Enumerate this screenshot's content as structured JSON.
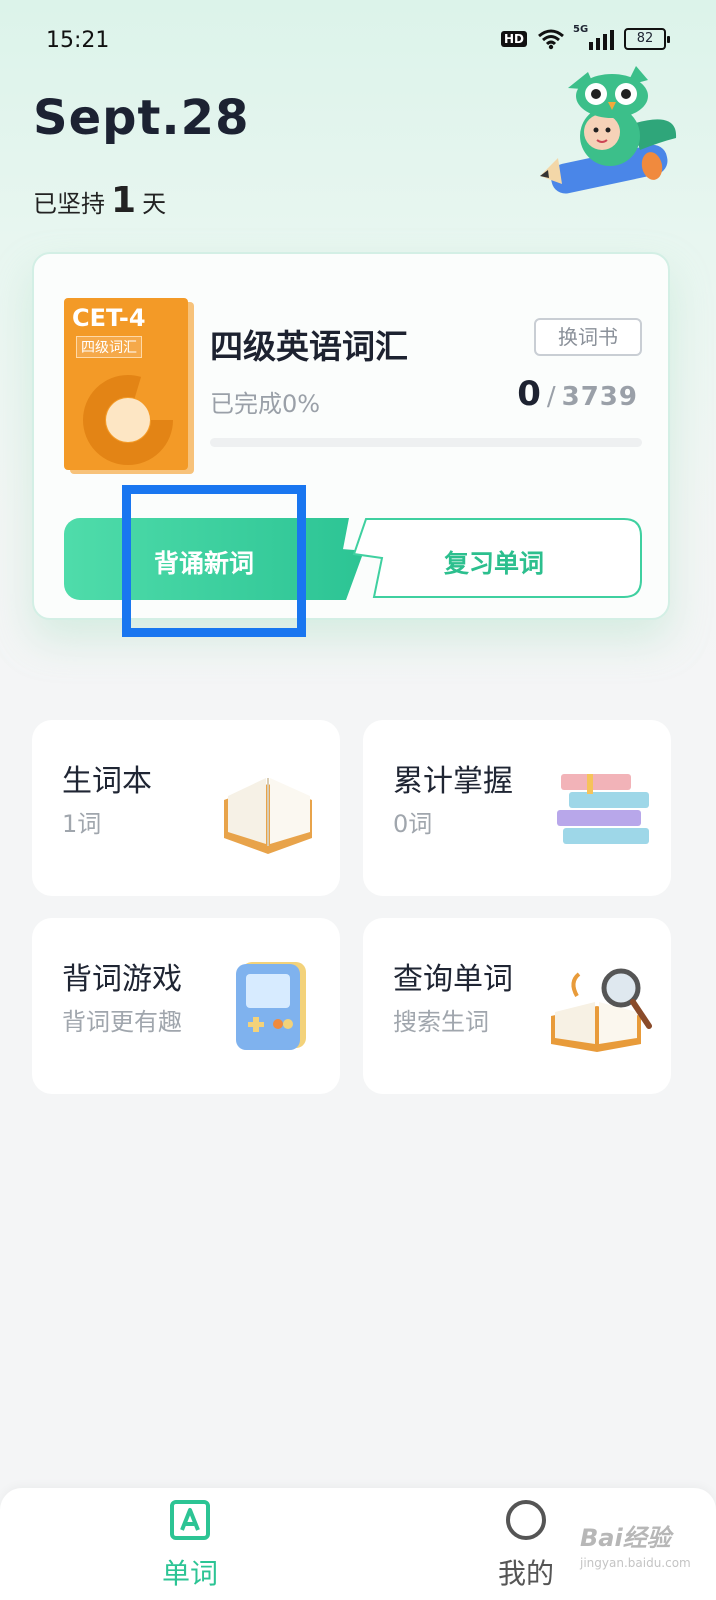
{
  "status_bar": {
    "time": "15:21",
    "hd": "HD",
    "network": "5G",
    "battery": "82"
  },
  "header": {
    "date": "Sept.28",
    "streak_prefix": "已坚持",
    "streak_days": "1",
    "streak_suffix": "天"
  },
  "book": {
    "cover_title": "CET-4",
    "cover_subtitle": "四级词汇",
    "name": "四级英语词汇",
    "change_label": "换词书",
    "progress_text": "已完成0%",
    "progress_fraction": 0,
    "learned": "0",
    "separator": "/",
    "total": "3739"
  },
  "actions": {
    "learn_label": "背诵新词",
    "review_label": "复习单词"
  },
  "tiles": [
    {
      "title": "生词本",
      "subtitle": "1词"
    },
    {
      "title": "累计掌握",
      "subtitle": "0词"
    },
    {
      "title": "背词游戏",
      "subtitle": "背词更有趣"
    },
    {
      "title": "查询单词",
      "subtitle": "搜索生词"
    }
  ],
  "nav": {
    "words_label": "单词",
    "mine_label": "我的",
    "active_color": "#2cc494"
  },
  "watermark": {
    "text": "Bai经验",
    "url": "jingyan.baidu.com"
  }
}
